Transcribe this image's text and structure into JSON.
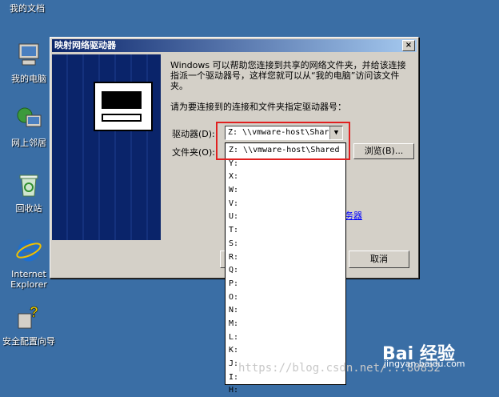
{
  "desktop": {
    "icons": [
      {
        "label": "我的文档"
      },
      {
        "label": "我的电脑"
      },
      {
        "label": "网上邻居"
      },
      {
        "label": "回收站"
      },
      {
        "label": "Internet Explorer"
      },
      {
        "label": "安全配置向导"
      }
    ]
  },
  "dialog": {
    "title": "映射网络驱动器",
    "close_label": "×",
    "description": "Windows 可以帮助您连接到共享的网络文件夹，并给该连接指派一个驱动器号，这样您就可以从“我的电脑”访问该文件夹。",
    "prompt": "请为要连接到的连接和文件夹指定驱动器号：",
    "drive_label": "驱动器(D):",
    "folder_label": "文件夹(O):",
    "drive_value": "Z:   \\\\vmware-host\\Shar",
    "browse_label": "浏览(B)...",
    "link_fragment": "务器",
    "cancel_label": "取消"
  },
  "dropdown": {
    "items": [
      "Z:   \\\\vmware-host\\Shared",
      "Y:",
      "X:",
      "W:",
      "V:",
      "U:",
      "T:",
      "S:",
      "R:",
      "Q:",
      "P:",
      "O:",
      "N:",
      "M:",
      "L:",
      "K:",
      "J:",
      "I:",
      "H:"
    ]
  },
  "watermark": {
    "url": "https://blog.csdn.ne",
    "url_tail": "t/...80832",
    "brand": "Bai 经验",
    "brand_sub": "jingyan.baidu.com"
  },
  "colors": {
    "desktop": "#3a6ea5",
    "titlebar": "#0a246a",
    "highlight": "#e02020"
  }
}
